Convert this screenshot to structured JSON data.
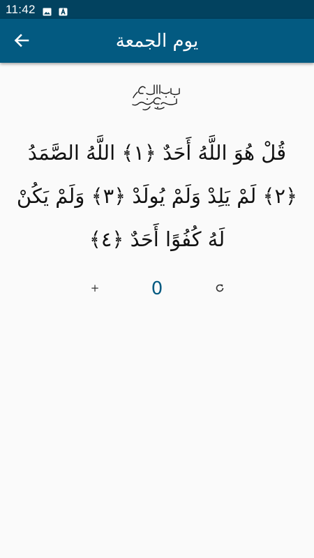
{
  "status_bar": {
    "time": "11:42",
    "background_color": "#02425f",
    "icons": [
      "image-icon",
      "a-badge-icon"
    ]
  },
  "app_bar": {
    "title": "يوم الجمعة",
    "back_icon": "arrow-left-icon",
    "background_color": "#035a81"
  },
  "content": {
    "basmala": "بسم الله الرحمن الرحيم",
    "verse_text": "قُلْ هُوَ اللَّهُ أَحَدٌ ﴿١﴾ اللَّهُ الصَّمَدُ ﴿٢﴾ لَمْ يَلِدْ وَلَمْ يُولَدْ ﴿٣﴾ وَلَمْ يَكُنْ لَهُ كُفُوًا أَحَدٌ ﴿٤﴾"
  },
  "counter": {
    "plus_label": "+",
    "value": "0",
    "reset_icon": "refresh-icon",
    "accent_color": "#035a81"
  }
}
